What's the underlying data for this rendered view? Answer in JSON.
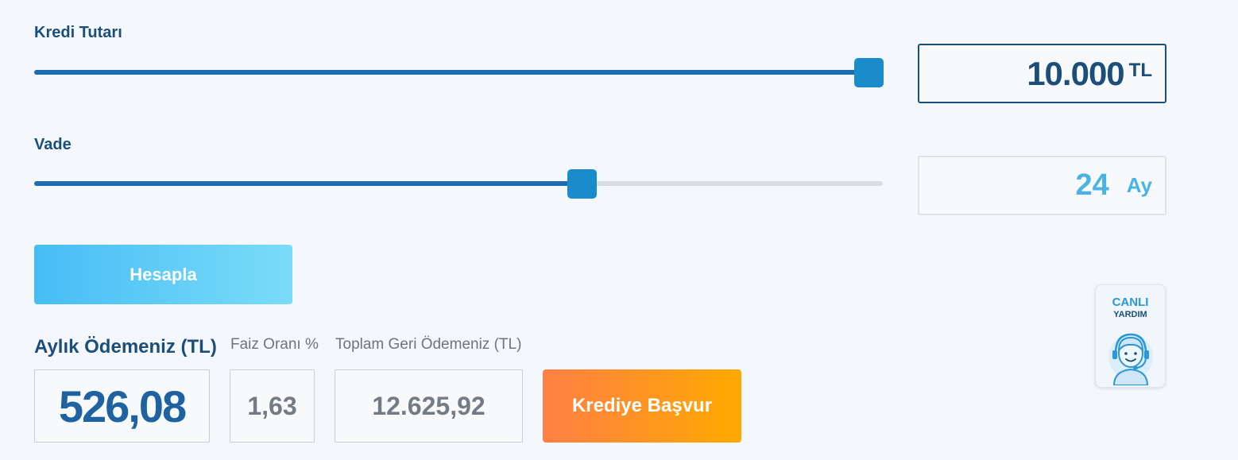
{
  "loan_amount": {
    "label": "Kredi Tutarı",
    "value": "10.000",
    "unit": "TL",
    "slider_fraction": 1.0
  },
  "term": {
    "label": "Vade",
    "value": "24",
    "unit": "Ay",
    "slider_fraction": 0.65
  },
  "calculate_button": {
    "label": "Hesapla"
  },
  "results": {
    "monthly_payment": {
      "label": "Aylık Ödemeniz (TL)",
      "value": "526,08"
    },
    "interest_rate": {
      "label": "Faiz Oranı %",
      "value": "1,63"
    },
    "total_repayment": {
      "label": "Toplam Geri Ödemeniz (TL)",
      "value": "12.625,92"
    }
  },
  "apply_button": {
    "label": "Krediye Başvur"
  },
  "live_help": {
    "line1": "CANLI",
    "line2": "YARDIM",
    "icon": "support-agent-icon"
  },
  "colors": {
    "primary": "#1b4f7a",
    "slider_fill": "#1e6cb0",
    "slider_thumb": "#1a8ccc",
    "accent_light": "#4ab3e6",
    "apply_gradient": [
      "#ff7f45",
      "#ffaa00"
    ],
    "calc_gradient": [
      "#47bdf5",
      "#7adcf8"
    ]
  }
}
